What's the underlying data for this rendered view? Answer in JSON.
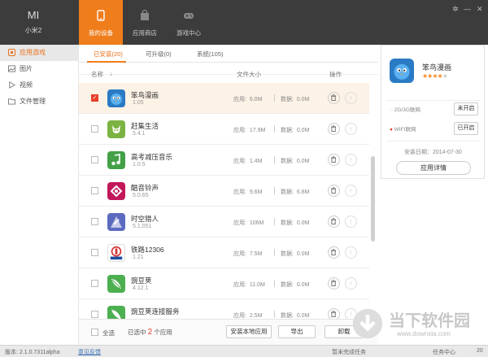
{
  "device": {
    "brand_logo": "MI",
    "name": "小米2"
  },
  "nav": {
    "tabs": [
      {
        "label": "我的设备",
        "icon": "phone-icon"
      },
      {
        "label": "应用商店",
        "icon": "bag-icon"
      },
      {
        "label": "游戏中心",
        "icon": "gamepad-icon"
      }
    ]
  },
  "window": {
    "settings": "✲",
    "minimize": "—",
    "close": "✕"
  },
  "sidebar": {
    "items": [
      {
        "label": "应用游戏",
        "icon": "app-icon"
      },
      {
        "label": "图片",
        "icon": "image-icon"
      },
      {
        "label": "视频",
        "icon": "video-icon"
      },
      {
        "label": "文件管理",
        "icon": "folder-icon"
      }
    ]
  },
  "subtabs": [
    {
      "label": "已安装(20)"
    },
    {
      "label": "可升级(0)"
    },
    {
      "label": "系统(105)"
    }
  ],
  "columns": {
    "name": "名称",
    "size": "文件大小",
    "action": "操作"
  },
  "labels": {
    "app_size": "应用:",
    "data_size": "数据:"
  },
  "apps": [
    {
      "name": "笨鸟漫画",
      "version": "1.05",
      "app": "6.0M",
      "data": "0.0M",
      "color": "#2a7bc4",
      "selected": true
    },
    {
      "name": "赶集生活",
      "version": "5.4.1",
      "app": "17.9M",
      "data": "0.0M",
      "color": "#7cb342",
      "selected": false
    },
    {
      "name": "高考减压音乐",
      "version": "1.0.5",
      "app": "1.4M",
      "data": "0.0M",
      "color": "#43a047",
      "selected": false
    },
    {
      "name": "酷音铃声",
      "version": "5.0.65",
      "app": "9.6M",
      "data": "6.8M",
      "color": "#c2185b",
      "selected": false
    },
    {
      "name": "时空猎人",
      "version": "5.1.051",
      "app": "106M",
      "data": "0.0M",
      "color": "#5c6bc0",
      "selected": false
    },
    {
      "name": "铁路12306",
      "version": "1.21",
      "app": "7.5M",
      "data": "0.0M",
      "color": "#1e4fa0",
      "selected": false
    },
    {
      "name": "豌豆荚",
      "version": "4.12.1",
      "app": "11.0M",
      "data": "0.0M",
      "color": "#4caf50",
      "selected": false
    },
    {
      "name": "豌豆荚连接服务",
      "version": "",
      "app": "2.5M",
      "data": "0.0M",
      "color": "#4caf50",
      "selected": false
    }
  ],
  "footer": {
    "select_all": "全选",
    "selected_prefix": "已选中",
    "selected_count": "2",
    "selected_suffix": "个应用",
    "install_local": "安装本地应用",
    "export": "导出",
    "uninstall": "卸载"
  },
  "detail": {
    "name": "笨鸟漫画",
    "rating": 4,
    "rating_max": 5,
    "net_2g3g": "2G/3G联网",
    "net_2g3g_state": "未开启",
    "net_wifi": "WIFI联网",
    "net_wifi_state": "已开启",
    "install_date": "安装日期：2014-07-30",
    "details_button": "应用详情"
  },
  "status": {
    "version": "版本: 2.1.0.7311alpha",
    "feedback": "意见反馈",
    "no_tasks": "暂未完成任务",
    "task_center": "任务中心",
    "count": "20"
  },
  "watermark": {
    "logo_text": "当下软件园",
    "url": "www.downxia.com"
  }
}
